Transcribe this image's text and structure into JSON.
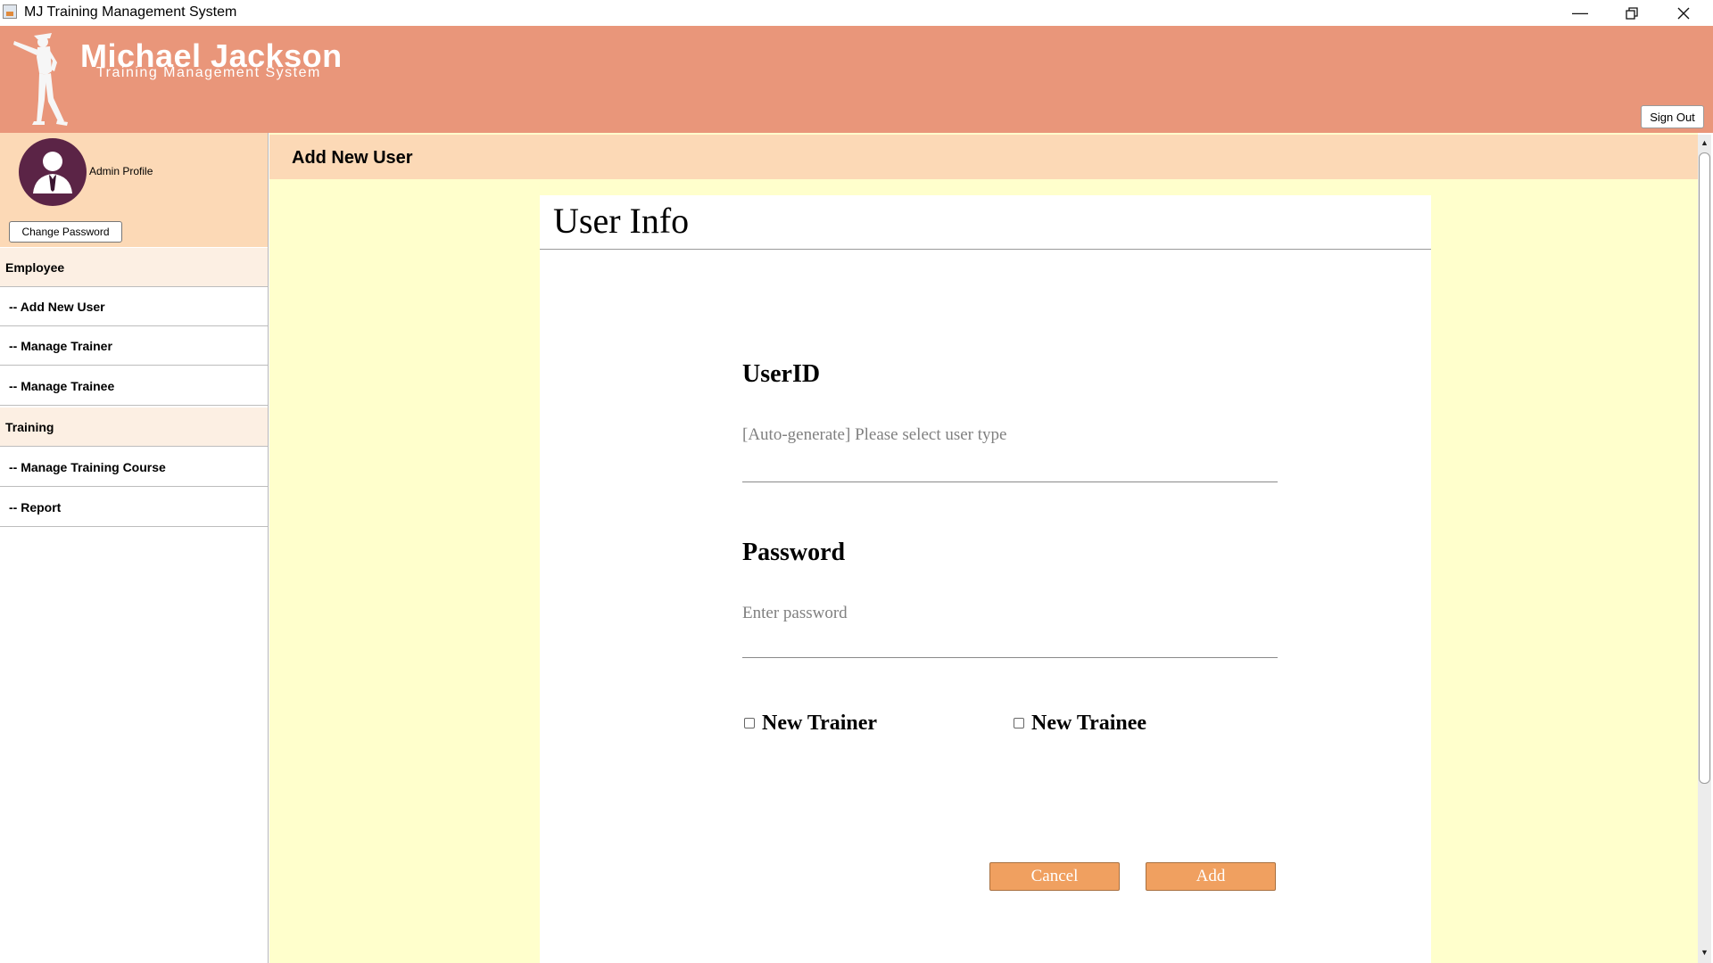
{
  "window": {
    "title": "MJ Training Management System",
    "controls": [
      "minimize-icon",
      "restore-icon",
      "close-icon"
    ]
  },
  "header": {
    "brand_title": "Michael Jackson",
    "brand_subtitle": "Training Management System",
    "sign_out_label": "Sign Out"
  },
  "sidebar": {
    "profile_label": "Admin Profile",
    "change_password_label": "Change Password",
    "items": [
      {
        "label": "Employee",
        "type": "section"
      },
      {
        "label": "-- Add New User",
        "type": "item"
      },
      {
        "label": "-- Manage Trainer",
        "type": "item"
      },
      {
        "label": "-- Manage Trainee",
        "type": "item"
      },
      {
        "label": "Training",
        "type": "section"
      },
      {
        "label": "-- Manage Training Course",
        "type": "item"
      },
      {
        "label": "-- Report",
        "type": "item"
      }
    ]
  },
  "main": {
    "page_title": "Add New User",
    "card_title": "User Info",
    "userid": {
      "label": "UserID",
      "value": "[Auto-generate] Please select user type"
    },
    "password": {
      "label": "Password",
      "placeholder": "Enter password"
    },
    "options": [
      {
        "label": "New Trainer",
        "checked": false
      },
      {
        "label": "New Trainee",
        "checked": false
      }
    ],
    "cancel_label": "Cancel",
    "add_label": "Add"
  },
  "colors": {
    "header": "#e9967a",
    "panel": "#fcd9b6",
    "content_bg": "#ffffcc",
    "button": "#f0a060",
    "avatar": "#5b2446"
  }
}
